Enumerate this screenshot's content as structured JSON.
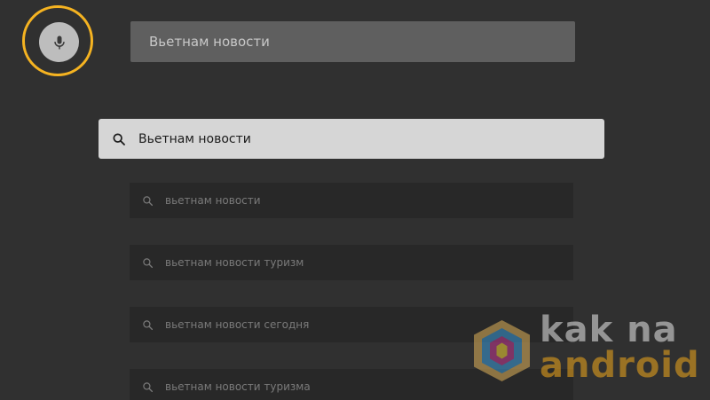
{
  "voice": {
    "mic_icon": "microphone-icon",
    "ring_color": "#f5b321"
  },
  "query": {
    "text": "Вьетнам новости"
  },
  "search": {
    "icon": "search-icon",
    "text": "Вьетнам новости"
  },
  "suggestions": [
    {
      "icon": "search-icon",
      "text": "вьетнам новости"
    },
    {
      "icon": "search-icon",
      "text": "вьетнам новости туризм"
    },
    {
      "icon": "search-icon",
      "text": "вьетнам новости сегодня"
    },
    {
      "icon": "search-icon",
      "text": "вьетнам новости туризма"
    }
  ],
  "watermark": {
    "line1": "kak na",
    "line2": "android"
  }
}
